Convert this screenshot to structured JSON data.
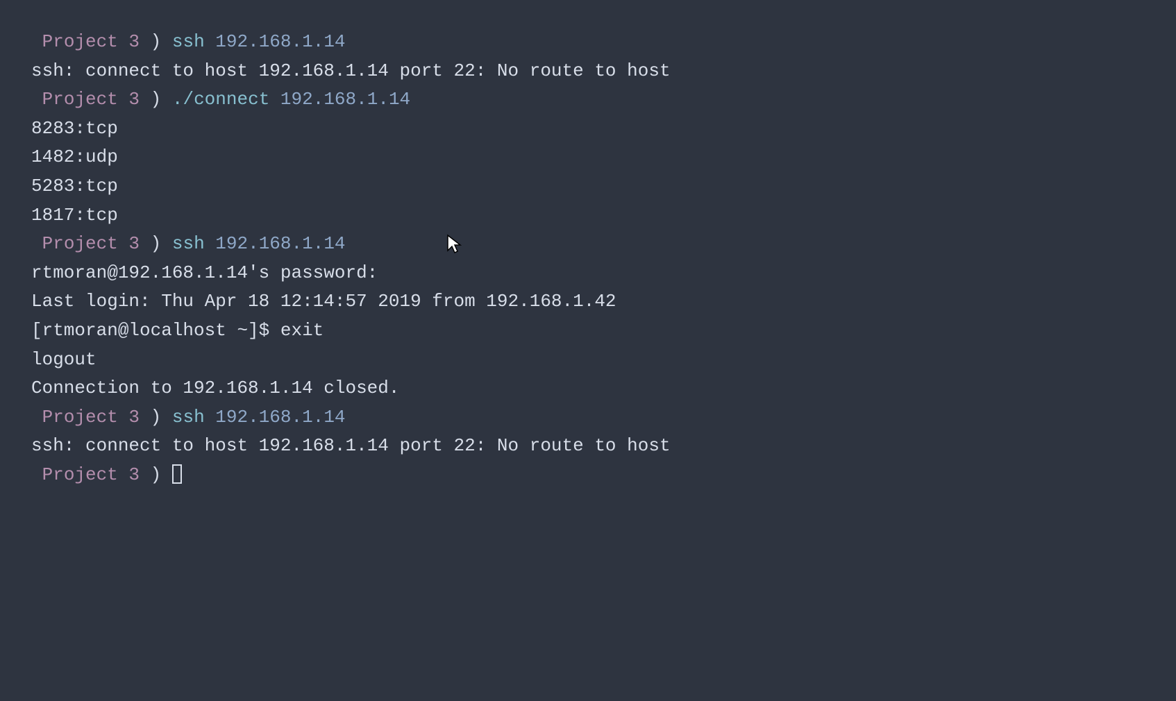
{
  "prompt": {
    "label": "Project 3",
    "bracket": ")"
  },
  "lines": [
    {
      "type": "prompt",
      "cmd": "ssh",
      "arg": "192.168.1.14"
    },
    {
      "type": "output",
      "text": "ssh: connect to host 192.168.1.14 port 22: No route to host"
    },
    {
      "type": "prompt",
      "cmd": "./connect",
      "arg": "192.168.1.14"
    },
    {
      "type": "output",
      "text": "8283:tcp"
    },
    {
      "type": "output",
      "text": "1482:udp"
    },
    {
      "type": "output",
      "text": "5283:tcp"
    },
    {
      "type": "output",
      "text": "1817:tcp"
    },
    {
      "type": "prompt",
      "cmd": "ssh",
      "arg": "192.168.1.14"
    },
    {
      "type": "output",
      "text": "rtmoran@192.168.1.14's password:"
    },
    {
      "type": "output",
      "text": "Last login: Thu Apr 18 12:14:57 2019 from 192.168.1.42"
    },
    {
      "type": "output",
      "text": "[rtmoran@localhost ~]$ exit"
    },
    {
      "type": "output",
      "text": "logout"
    },
    {
      "type": "output",
      "text": "Connection to 192.168.1.14 closed."
    },
    {
      "type": "prompt",
      "cmd": "ssh",
      "arg": "192.168.1.14"
    },
    {
      "type": "output",
      "text": "ssh: connect to host 192.168.1.14 port 22: No route to host"
    },
    {
      "type": "prompt-empty"
    }
  ]
}
